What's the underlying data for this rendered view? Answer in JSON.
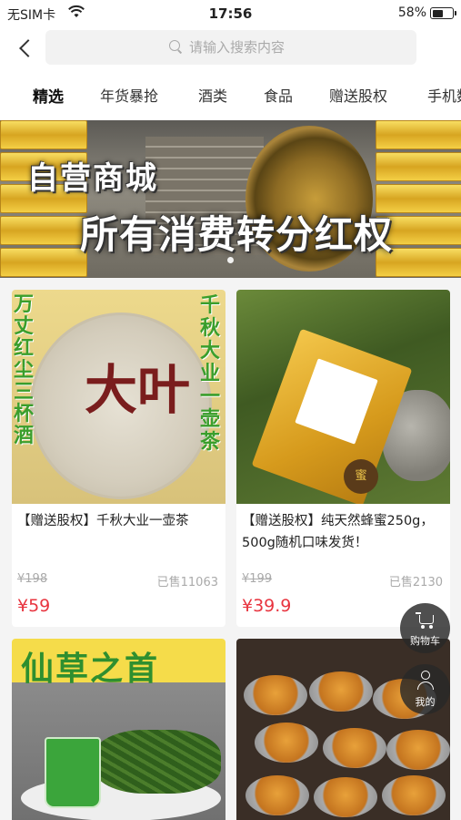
{
  "status_bar": {
    "carrier": "无SIM卡",
    "time": "17:56",
    "battery_text": "58%",
    "battery_level": 0.58
  },
  "header": {
    "search_placeholder": "请输入搜索内容"
  },
  "tabs": [
    "精选",
    "年货暴抢",
    "酒类",
    "食品",
    "赠送股权",
    "手机数码"
  ],
  "banner": {
    "line1": "自营商城",
    "line2": "所有消费转分红权"
  },
  "products": [
    {
      "title": "【赠送股权】千秋大业一壶茶",
      "old_price": "¥198",
      "sold": "已售11063",
      "price": "¥59",
      "image_text_left": "万丈红尘三杯酒",
      "image_text_right": "千秋大业一壶茶",
      "image_center": "大叶"
    },
    {
      "title": "【赠送股权】纯天然蜂蜜250g，500g随机口味发货！",
      "old_price": "¥199",
      "sold": "已售2130",
      "price": "¥39.9",
      "image_badge": "蜜"
    },
    {
      "image_title": "仙草之首"
    },
    {}
  ],
  "fabs": {
    "cart_label": "购物车",
    "mine_label": "我的"
  },
  "colors": {
    "price": "#e8343f",
    "accent_gold": "#d7a521"
  }
}
